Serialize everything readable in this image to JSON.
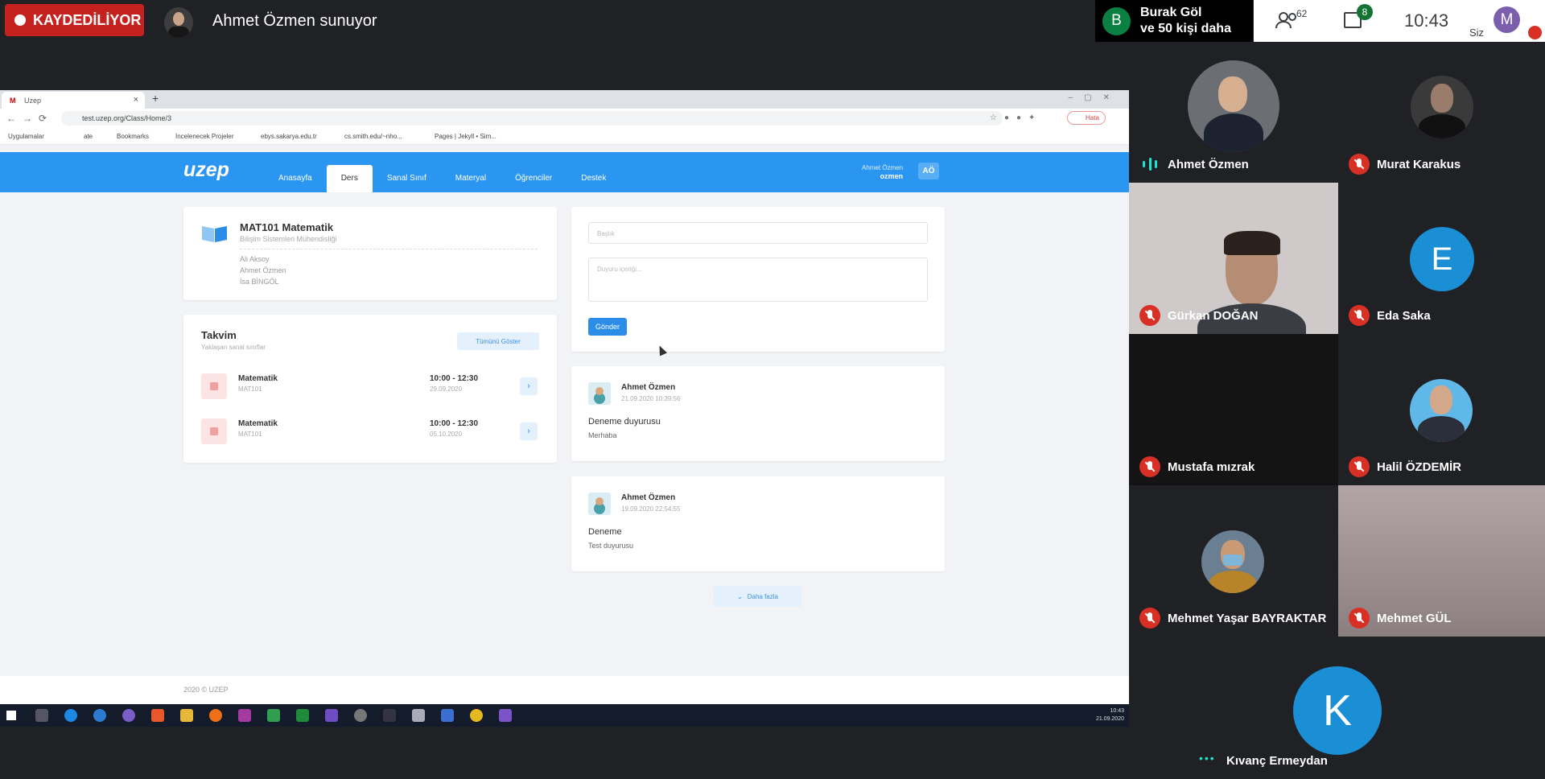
{
  "meet": {
    "recording_label": "KAYDEDİLİYOR",
    "presenter_text": "Ahmet Özmen sunuyor",
    "notice": {
      "initial": "B",
      "line1": "Burak Göl",
      "line2": "ve 50 kişi daha"
    },
    "participants_count": "62",
    "chat_badge": "8",
    "time": "10:43",
    "me_initial": "M",
    "me_label": "Siz"
  },
  "browser": {
    "tab_title": "Uzep",
    "url": "test.uzep.org/Class/Home/3",
    "profile_label": "Hata",
    "bookmarks": [
      "Uygulamalar",
      "ate",
      "Bookmarks",
      "İncelenecek Projeler",
      "ebys.sakarya.edu.tr",
      "cs.smith.edu/~nho...",
      "Pages | Jekyll • Sim..."
    ]
  },
  "app": {
    "logo": "uzep",
    "menu": [
      "Anasayfa",
      "Ders",
      "Sanal Sınıf",
      "Materyal",
      "Öğrenciler",
      "Destek"
    ],
    "active_menu": "Ders",
    "user_name": "Ahmet Özmen",
    "user_login": "ozmen",
    "user_badge": "AÖ",
    "course": {
      "title": "MAT101 Matematik",
      "department": "Bilişim Sistemleri Mühendisliği",
      "instructors": [
        "Ali Aksoy",
        "Ahmet Özmen",
        "İsa BİNGÖL"
      ]
    },
    "calendar": {
      "title": "Takvim",
      "subtitle": "Yaklaşan sanal sınıflar",
      "show_all": "Tümünü Göster",
      "events": [
        {
          "title": "Matematik",
          "code": "MAT101",
          "time": "10:00 - 12:30",
          "date": "29.09.2020"
        },
        {
          "title": "Matematik",
          "code": "MAT101",
          "time": "10:00 - 12:30",
          "date": "05.10.2020"
        }
      ]
    },
    "form": {
      "title_placeholder": "Başlık",
      "content_placeholder": "Duyuru içeriği...",
      "send_label": "Gönder"
    },
    "announcements": [
      {
        "author": "Ahmet Özmen",
        "date": "21.09.2020 10:39:56",
        "title": "Deneme duyurusu",
        "body": "Merhaba"
      },
      {
        "author": "Ahmet Özmen",
        "date": "19.09.2020 22:54:55",
        "title": "Deneme",
        "body": "Test duyurusu"
      }
    ],
    "more_label": "Daha fazla",
    "footer": "2020 © UZEP"
  },
  "taskbar": {
    "time": "10:43",
    "date": "21.09.2020"
  },
  "participants": [
    {
      "name": "Ahmet Özmen",
      "muted": false,
      "speaking": true
    },
    {
      "name": "Murat Karakus",
      "muted": true
    },
    {
      "name": "Gürkan DOĞAN",
      "muted": true
    },
    {
      "name": "Eda Saka",
      "muted": true,
      "initial": "E",
      "color": "#1a8fd6"
    },
    {
      "name": "Mustafa mızrak",
      "muted": true
    },
    {
      "name": "Halil ÖZDEMİR",
      "muted": true
    },
    {
      "name": "Mehmet Yaşar BAYRAKTAR",
      "muted": true
    },
    {
      "name": "Mehmet GÜL",
      "muted": true
    },
    {
      "name": "Kıvanç Ermeydan",
      "muted": false,
      "initial": "K",
      "color": "#1a8fd6"
    }
  ],
  "colors": {
    "app_blue": "#2b96f2",
    "record_red": "#c5221f",
    "mic_red": "#d93025",
    "speaking": "#1ee3cf"
  }
}
